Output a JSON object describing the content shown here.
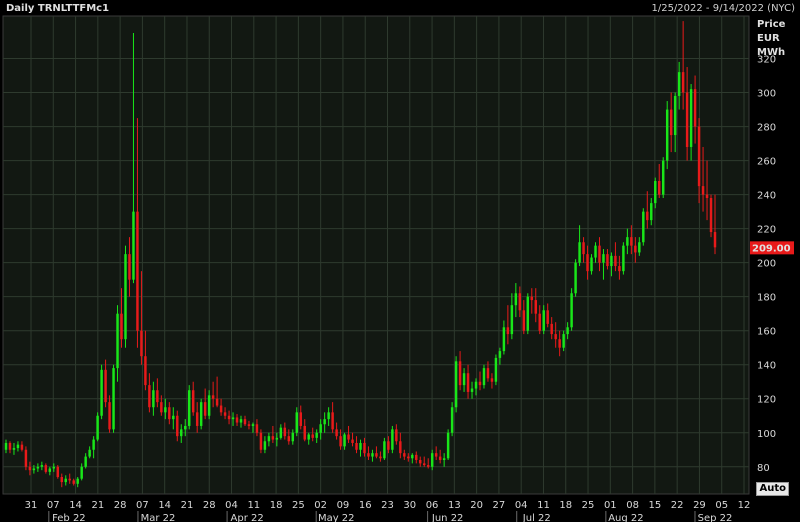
{
  "header": {
    "title": "Daily TRNLTTFMc1",
    "range": "1/25/2022 - 9/14/2022 (NYC)"
  },
  "axis": {
    "unit_lines": [
      "Price",
      "EUR",
      "MWh"
    ]
  },
  "last_price": "209.00",
  "auto_label": "Auto",
  "colors": {
    "background": "#000000",
    "plot_bg": "#121812",
    "grid": "#2e3a2e",
    "up": "#19e619",
    "down": "#e81a1a",
    "last_tag": "#e81a1a"
  },
  "chart_data": {
    "type": "candlestick",
    "ylim": [
      64,
      345
    ],
    "yticks": [
      80,
      100,
      120,
      140,
      160,
      180,
      200,
      220,
      240,
      260,
      280,
      300,
      320
    ],
    "x_tick_labels": [
      "31",
      "07",
      "14",
      "21",
      "28",
      "07",
      "14",
      "21",
      "28",
      "04",
      "11",
      "18",
      "25",
      "02",
      "09",
      "16",
      "23",
      "30",
      "06",
      "13",
      "20",
      "27",
      "04",
      "11",
      "18",
      "25",
      "01",
      "08",
      "15",
      "22",
      "29",
      "05",
      "12"
    ],
    "month_labels": [
      "Feb 22",
      "Mar 22",
      "Apr 22",
      "May 22",
      "Jun 22",
      "Jul 22",
      "Aug 22",
      "Sep 22"
    ],
    "candles": [
      [
        90,
        96,
        88,
        94
      ],
      [
        94,
        95,
        88,
        90
      ],
      [
        90,
        94,
        87,
        91
      ],
      [
        91,
        95,
        89,
        93
      ],
      [
        93,
        95,
        89,
        90
      ],
      [
        90,
        92,
        78,
        80
      ],
      [
        80,
        83,
        75,
        78
      ],
      [
        78,
        81,
        76,
        79
      ],
      [
        79,
        82,
        77,
        80
      ],
      [
        80,
        83,
        78,
        81
      ],
      [
        81,
        82,
        76,
        77
      ],
      [
        77,
        80,
        75,
        79
      ],
      [
        79,
        82,
        77,
        80
      ],
      [
        80,
        81,
        73,
        74
      ],
      [
        74,
        76,
        68,
        71
      ],
      [
        71,
        75,
        69,
        73
      ],
      [
        73,
        76,
        70,
        72
      ],
      [
        72,
        73,
        69,
        70
      ],
      [
        70,
        74,
        68,
        73
      ],
      [
        73,
        82,
        72,
        80
      ],
      [
        80,
        88,
        79,
        86
      ],
      [
        86,
        92,
        85,
        90
      ],
      [
        90,
        98,
        85,
        96
      ],
      [
        96,
        112,
        95,
        110
      ],
      [
        110,
        140,
        108,
        137
      ],
      [
        137,
        143,
        115,
        118
      ],
      [
        118,
        122,
        100,
        102
      ],
      [
        102,
        140,
        100,
        138
      ],
      [
        138,
        175,
        130,
        170
      ],
      [
        170,
        185,
        150,
        155
      ],
      [
        155,
        210,
        150,
        205
      ],
      [
        205,
        215,
        180,
        190
      ],
      [
        190,
        335,
        188,
        230
      ],
      [
        230,
        285,
        150,
        160
      ],
      [
        160,
        195,
        140,
        145
      ],
      [
        145,
        160,
        125,
        128
      ],
      [
        128,
        135,
        112,
        115
      ],
      [
        115,
        130,
        110,
        125
      ],
      [
        125,
        132,
        115,
        118
      ],
      [
        118,
        122,
        110,
        112
      ],
      [
        112,
        120,
        108,
        115
      ],
      [
        115,
        118,
        105,
        108
      ],
      [
        108,
        115,
        102,
        110
      ],
      [
        110,
        113,
        95,
        98
      ],
      [
        98,
        105,
        94,
        102
      ],
      [
        102,
        108,
        98,
        104
      ],
      [
        104,
        128,
        102,
        125
      ],
      [
        125,
        130,
        110,
        112
      ],
      [
        112,
        118,
        100,
        104
      ],
      [
        104,
        120,
        102,
        118
      ],
      [
        118,
        126,
        108,
        110
      ],
      [
        110,
        125,
        108,
        122
      ],
      [
        122,
        130,
        115,
        120
      ],
      [
        120,
        133,
        115,
        116
      ],
      [
        116,
        120,
        110,
        112
      ],
      [
        112,
        115,
        108,
        110
      ],
      [
        110,
        113,
        105,
        108
      ],
      [
        108,
        112,
        104,
        109
      ],
      [
        109,
        111,
        104,
        106
      ],
      [
        106,
        110,
        103,
        108
      ],
      [
        108,
        110,
        104,
        105
      ],
      [
        105,
        107,
        102,
        104
      ],
      [
        104,
        106,
        100,
        105
      ],
      [
        105,
        108,
        98,
        100
      ],
      [
        100,
        102,
        88,
        90
      ],
      [
        90,
        98,
        88,
        95
      ],
      [
        95,
        100,
        92,
        98
      ],
      [
        98,
        104,
        94,
        96
      ],
      [
        96,
        100,
        92,
        97
      ],
      [
        97,
        105,
        96,
        103
      ],
      [
        103,
        106,
        96,
        98
      ],
      [
        98,
        102,
        93,
        95
      ],
      [
        95,
        102,
        93,
        100
      ],
      [
        100,
        115,
        98,
        112
      ],
      [
        112,
        116,
        102,
        104
      ],
      [
        104,
        108,
        95,
        96
      ],
      [
        96,
        100,
        93,
        99
      ],
      [
        99,
        103,
        95,
        97
      ],
      [
        97,
        102,
        94,
        100
      ],
      [
        100,
        108,
        96,
        105
      ],
      [
        105,
        112,
        100,
        108
      ],
      [
        108,
        115,
        104,
        112
      ],
      [
        112,
        118,
        100,
        102
      ],
      [
        102,
        106,
        96,
        98
      ],
      [
        98,
        102,
        90,
        92
      ],
      [
        92,
        100,
        90,
        99
      ],
      [
        99,
        104,
        94,
        96
      ],
      [
        96,
        100,
        92,
        94
      ],
      [
        94,
        98,
        88,
        90
      ],
      [
        90,
        96,
        86,
        94
      ],
      [
        94,
        97,
        86,
        88
      ],
      [
        88,
        92,
        84,
        86
      ],
      [
        86,
        90,
        83,
        88
      ],
      [
        88,
        92,
        85,
        86
      ],
      [
        86,
        89,
        83,
        85
      ],
      [
        85,
        97,
        84,
        95
      ],
      [
        95,
        98,
        88,
        90
      ],
      [
        90,
        104,
        88,
        102
      ],
      [
        102,
        105,
        93,
        95
      ],
      [
        95,
        100,
        85,
        88
      ],
      [
        88,
        90,
        84,
        86
      ],
      [
        86,
        88,
        83,
        85
      ],
      [
        85,
        88,
        82,
        87
      ],
      [
        87,
        89,
        82,
        84
      ],
      [
        84,
        86,
        80,
        82
      ],
      [
        82,
        86,
        80,
        81
      ],
      [
        81,
        85,
        79,
        80
      ],
      [
        80,
        90,
        78,
        88
      ],
      [
        88,
        92,
        84,
        86
      ],
      [
        86,
        90,
        82,
        84
      ],
      [
        84,
        88,
        80,
        85
      ],
      [
        85,
        102,
        84,
        100
      ],
      [
        100,
        118,
        98,
        115
      ],
      [
        115,
        145,
        112,
        142
      ],
      [
        142,
        148,
        125,
        128
      ],
      [
        128,
        138,
        124,
        135
      ],
      [
        135,
        140,
        120,
        124
      ],
      [
        124,
        130,
        120,
        126
      ],
      [
        126,
        132,
        122,
        130
      ],
      [
        130,
        136,
        125,
        128
      ],
      [
        128,
        140,
        126,
        138
      ],
      [
        138,
        142,
        130,
        132
      ],
      [
        132,
        135,
        126,
        130
      ],
      [
        130,
        146,
        128,
        144
      ],
      [
        144,
        150,
        140,
        148
      ],
      [
        148,
        166,
        146,
        162
      ],
      [
        162,
        175,
        152,
        158
      ],
      [
        158,
        182,
        155,
        175
      ],
      [
        175,
        188,
        168,
        182
      ],
      [
        182,
        186,
        168,
        172
      ],
      [
        172,
        178,
        158,
        160
      ],
      [
        160,
        182,
        158,
        180
      ],
      [
        180,
        185,
        170,
        178
      ],
      [
        178,
        185,
        165,
        170
      ],
      [
        170,
        175,
        158,
        160
      ],
      [
        160,
        175,
        158,
        172
      ],
      [
        172,
        176,
        162,
        164
      ],
      [
        164,
        168,
        155,
        158
      ],
      [
        158,
        165,
        150,
        155
      ],
      [
        155,
        160,
        145,
        150
      ],
      [
        150,
        160,
        148,
        158
      ],
      [
        158,
        165,
        155,
        162
      ],
      [
        162,
        185,
        160,
        182
      ],
      [
        182,
        202,
        180,
        200
      ],
      [
        200,
        222,
        198,
        212
      ],
      [
        212,
        215,
        200,
        205
      ],
      [
        205,
        210,
        190,
        195
      ],
      [
        195,
        205,
        193,
        203
      ],
      [
        203,
        212,
        200,
        210
      ],
      [
        210,
        215,
        195,
        200
      ],
      [
        200,
        208,
        190,
        205
      ],
      [
        205,
        208,
        196,
        198
      ],
      [
        198,
        206,
        192,
        204
      ],
      [
        204,
        212,
        195,
        198
      ],
      [
        198,
        204,
        190,
        195
      ],
      [
        195,
        212,
        193,
        210
      ],
      [
        210,
        220,
        205,
        215
      ],
      [
        215,
        222,
        205,
        210
      ],
      [
        210,
        215,
        200,
        206
      ],
      [
        206,
        215,
        204,
        212
      ],
      [
        212,
        232,
        210,
        230
      ],
      [
        230,
        242,
        220,
        225
      ],
      [
        225,
        238,
        222,
        235
      ],
      [
        235,
        250,
        232,
        248
      ],
      [
        248,
        258,
        238,
        240
      ],
      [
        240,
        262,
        238,
        260
      ],
      [
        260,
        295,
        255,
        290
      ],
      [
        290,
        300,
        265,
        275
      ],
      [
        275,
        300,
        265,
        298
      ],
      [
        298,
        318,
        290,
        312
      ],
      [
        312,
        342,
        290,
        300
      ],
      [
        300,
        315,
        260,
        268
      ],
      [
        268,
        305,
        260,
        302
      ],
      [
        302,
        310,
        270,
        280
      ],
      [
        280,
        285,
        235,
        245
      ],
      [
        245,
        268,
        230,
        240
      ],
      [
        240,
        260,
        225,
        238
      ],
      [
        238,
        240,
        215,
        218
      ],
      [
        218,
        240,
        205,
        209
      ]
    ]
  }
}
